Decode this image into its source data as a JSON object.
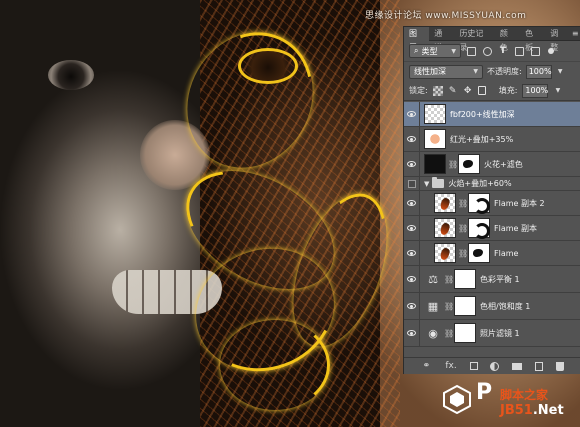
{
  "watermark": "思缘设计论坛 www.MISSYUAN.com",
  "logos": {
    "ps_letter": "P",
    "site_line1": "脚本之家",
    "site_line2_a": "JB51",
    "site_line2_b": ".Net"
  },
  "panel": {
    "tabs": [
      "图层",
      "通道",
      "历史记录",
      "颜色",
      "色板",
      "调整"
    ],
    "active_tab": "图层",
    "filter": {
      "kind_label": "类型"
    },
    "blend_mode": "线性加深",
    "opacity_label": "不透明度:",
    "opacity_value": "100%",
    "lock_label": "锁定:",
    "fill_label": "填充:",
    "fill_value": "100%",
    "layers": [
      {
        "name": "fbf200+线性加深",
        "selected": true
      },
      {
        "name": "红光+叠加+35%"
      },
      {
        "name": "火花+滤色"
      },
      {
        "name": "火焰+叠加+60%",
        "group": true
      },
      {
        "name": "Flame 副本 2"
      },
      {
        "name": "Flame 副本"
      },
      {
        "name": "Flame"
      },
      {
        "name": "色彩平衡 1",
        "adj_icon": "⚖"
      },
      {
        "name": "色相/饱和度 1",
        "adj_icon": "▦"
      },
      {
        "name": "照片滤镜 1",
        "adj_icon": "◉"
      }
    ],
    "bottom_icons": [
      "link",
      "fx",
      "mask",
      "adjustment",
      "group",
      "new-layer",
      "delete"
    ],
    "bottom_glyphs": {
      "link": "⚭",
      "fx": "fx."
    }
  }
}
